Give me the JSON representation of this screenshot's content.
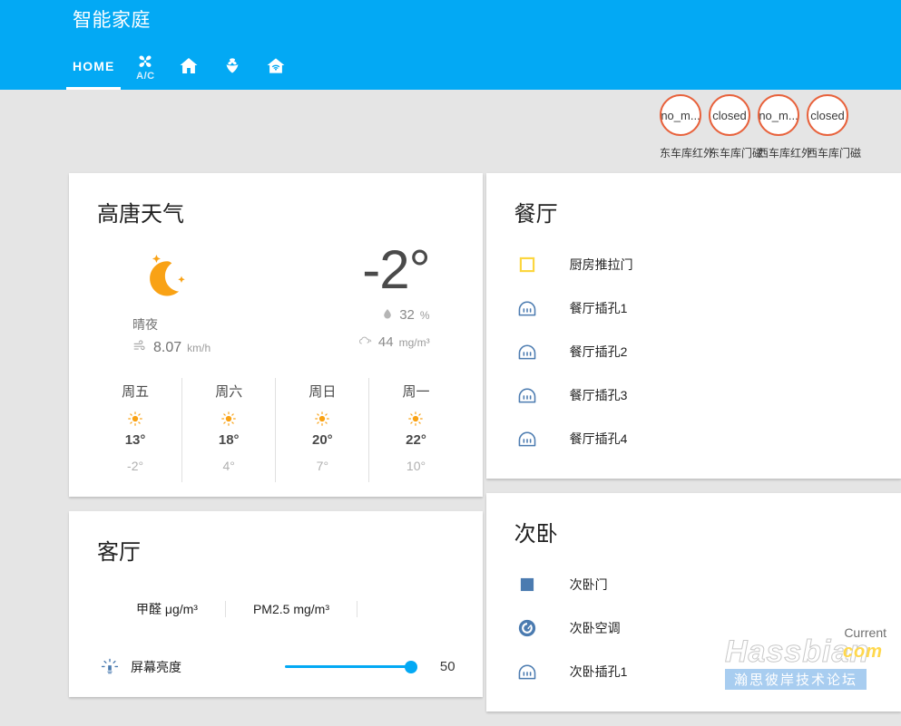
{
  "header": {
    "title": "智能家庭",
    "tabs": [
      {
        "label": "HOME",
        "icon": "text-home",
        "active": true
      },
      {
        "label": "A/C",
        "icon": "fan-ac-icon",
        "active": false
      },
      {
        "label": "",
        "icon": "house-icon",
        "active": false
      },
      {
        "label": "",
        "icon": "flower-icon",
        "active": false
      },
      {
        "label": "",
        "icon": "home-wifi-icon",
        "active": false
      }
    ],
    "accent_color": "#03a9f4"
  },
  "badges": [
    {
      "state": "no_m...",
      "label": "东车库红外"
    },
    {
      "state": "closed",
      "label": "东车库门磁"
    },
    {
      "state": "no_m...",
      "label": "西车库红外"
    },
    {
      "state": "closed",
      "label": "西车库门磁"
    }
  ],
  "badge_border_color": "#e8623c",
  "weather": {
    "title": "高唐天气",
    "condition": "晴夜",
    "condition_icon": "moon-stars-icon",
    "wind": "8.07",
    "wind_unit": "km/h",
    "wind_icon": "wind-icon",
    "temperature": "-2°",
    "humidity_value": "32",
    "humidity_unit": "%",
    "humidity_icon": "water-drop-icon",
    "air_value": "44",
    "air_unit": "mg/m³",
    "air_icon": "cloud-wind-icon",
    "forecast": [
      {
        "day": "周五",
        "icon": "sun-icon",
        "high": "13°",
        "low": "-2°"
      },
      {
        "day": "周六",
        "icon": "sun-icon",
        "high": "18°",
        "low": "4°"
      },
      {
        "day": "周日",
        "icon": "sun-icon",
        "high": "20°",
        "low": "7°"
      },
      {
        "day": "周一",
        "icon": "sun-icon",
        "high": "22°",
        "low": "10°"
      }
    ]
  },
  "living_room": {
    "title": "客厅",
    "sensors": [
      {
        "label": "甲醛 μg/m³"
      },
      {
        "label": "PM2.5 mg/m³"
      }
    ],
    "slider": {
      "icon": "brightness-icon",
      "label": "屏幕亮度",
      "value": "50"
    }
  },
  "dining_room": {
    "title": "餐厅",
    "items": [
      {
        "name": "厨房推拉门",
        "icon": "door-open-square-icon"
      },
      {
        "name": "餐厅插孔1",
        "icon": "power-socket-icon"
      },
      {
        "name": "餐厅插孔2",
        "icon": "power-socket-icon"
      },
      {
        "name": "餐厅插孔3",
        "icon": "power-socket-icon"
      },
      {
        "name": "餐厅插孔4",
        "icon": "power-socket-icon"
      }
    ]
  },
  "second_bedroom": {
    "title": "次卧",
    "items": [
      {
        "name": "次卧门",
        "icon": "door-closed-square-icon"
      },
      {
        "name": "次卧空调",
        "icon": "air-conditioner-gauge-icon"
      },
      {
        "name": "次卧插孔1",
        "icon": "power-socket-icon"
      }
    ]
  },
  "watermark": {
    "current": "Current",
    "brand": "Hassbian",
    "tld": "com",
    "forum": "瀚思彼岸技术论坛"
  }
}
